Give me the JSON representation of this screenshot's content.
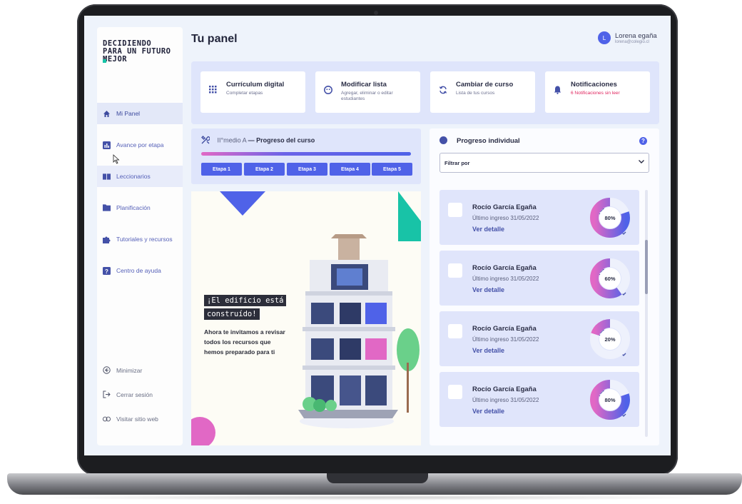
{
  "sidebar": {
    "logo": [
      "DECIDIENDO",
      "PARA UN FUTURO",
      "MEJOR"
    ],
    "items": [
      {
        "label": "Mi Panel",
        "icon": "home-icon"
      },
      {
        "label": "Avance por etapa",
        "icon": "bar-chart-icon"
      },
      {
        "label": "Leccionarios",
        "icon": "book-icon"
      },
      {
        "label": "Planificación",
        "icon": "folder-icon"
      },
      {
        "label": "Tutoriales y recursos",
        "icon": "puzzle-icon"
      },
      {
        "label": "Centro de ayuda",
        "icon": "question-icon"
      }
    ],
    "bottom": [
      {
        "label": "Minimizar",
        "icon": "arrow-left-circle-icon"
      },
      {
        "label": "Cerrar sesión",
        "icon": "logout-icon"
      },
      {
        "label": "Visitar sitio web",
        "icon": "link-icon"
      }
    ]
  },
  "header": {
    "title": "Tu panel",
    "user": {
      "initial": "L",
      "name": "Lorena egaña",
      "email": "lorena@colegio.cl"
    }
  },
  "quick_actions": [
    {
      "title": "Currículum digital",
      "subtitle": "Completar etapas",
      "icon": "grid-icon"
    },
    {
      "title": "Modificar lista",
      "subtitle": "Agregar, eliminar o editar estudiantes",
      "icon": "user-icon"
    },
    {
      "title": "Cambiar de curso",
      "subtitle": "Lista de tus cursos",
      "icon": "refresh-icon"
    },
    {
      "title": "Notificaciones",
      "subtitle": "6 Notificaciones sin leer",
      "icon": "bell-icon"
    }
  ],
  "course_progress": {
    "level": "II°medio A",
    "separator": "—",
    "title": "Progreso del curso",
    "progress": 1.0,
    "stages": [
      "Etapa 1",
      "Etapa 2",
      "Etapa 3",
      "Etapa 4",
      "Etapa 5"
    ]
  },
  "illustration": {
    "tag_line1": "¡El edificio está",
    "tag_line2": "construído!",
    "body": "Ahora te invitamos a revisar todos los recursos que hemos preparado para ti"
  },
  "individual": {
    "title": "Progreso individual",
    "filter_label": "Filtrar por",
    "students": [
      {
        "name": "Rocío García Egaña",
        "last_login": "Último ingreso 31/05/2022",
        "detail": "Ver detalle",
        "percent": 80,
        "percent_label": "80%"
      },
      {
        "name": "Rocío García Egaña",
        "last_login": "Último ingreso 31/05/2022",
        "detail": "Ver detalle",
        "percent": 60,
        "percent_label": "60%"
      },
      {
        "name": "Rocío García Egaña",
        "last_login": "Último ingreso 31/05/2022",
        "detail": "Ver detalle",
        "percent": 20,
        "percent_label": "20%"
      },
      {
        "name": "Rocío García Egaña",
        "last_login": "Último ingreso 31/05/2022",
        "detail": "Ver detalle",
        "percent": 80,
        "percent_label": "80%"
      }
    ]
  },
  "colors": {
    "accent": "#4f62e8",
    "teal": "#18c3a7",
    "pink": "#e168c5",
    "alert": "#e0245e"
  }
}
